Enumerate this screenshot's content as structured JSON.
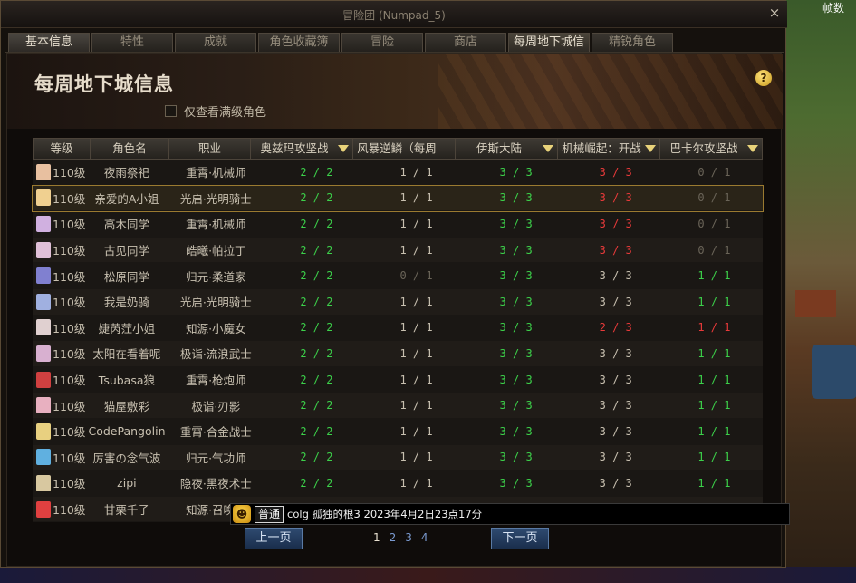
{
  "fps_label": "帧数",
  "window": {
    "title": "冒险团 (Numpad_5)",
    "close": "×"
  },
  "tabs": [
    {
      "label": "基本信息"
    },
    {
      "label": "特性"
    },
    {
      "label": "成就"
    },
    {
      "label": "角色收藏簿"
    },
    {
      "label": "冒险"
    },
    {
      "label": "商店"
    },
    {
      "label": "每周地下城信息"
    },
    {
      "label": "精锐角色"
    }
  ],
  "active_tab": "每周地下城信息",
  "page": {
    "title": "每周地下城信息",
    "help": "?",
    "filter_label": "仅查看满级角色"
  },
  "table": {
    "headers": {
      "level": "等级",
      "name": "角色名",
      "job": "职业",
      "d1": "奥兹玛攻坚战",
      "d2": "风暴逆鳞（每周",
      "d3": "伊斯大陆",
      "d4": "机械崛起：开战",
      "d5": "巴卡尔攻坚战"
    },
    "rows": [
      {
        "level": "110级",
        "name": "夜雨祭祀",
        "job": "重霄·机械师",
        "d1": "2 / 2",
        "d2": "1 / 1",
        "d3": "3 / 3",
        "d4": "3 / 3",
        "d5": "0 / 1",
        "c1": "green",
        "c2": "white",
        "c3": "green",
        "c4": "red",
        "c5": "grey",
        "avatar": "#e8c0a0"
      },
      {
        "level": "110级",
        "name": "亲爱的A小姐",
        "job": "光启·光明骑士",
        "d1": "2 / 2",
        "d2": "1 / 1",
        "d3": "3 / 3",
        "d4": "3 / 3",
        "d5": "0 / 1",
        "c1": "green",
        "c2": "white",
        "c3": "green",
        "c4": "red",
        "c5": "grey",
        "avatar": "#f0d090"
      },
      {
        "level": "110级",
        "name": "高木同学",
        "job": "重霄·机械师",
        "d1": "2 / 2",
        "d2": "1 / 1",
        "d3": "3 / 3",
        "d4": "3 / 3",
        "d5": "0 / 1",
        "c1": "green",
        "c2": "white",
        "c3": "green",
        "c4": "red",
        "c5": "grey",
        "avatar": "#d0b0e0"
      },
      {
        "level": "110级",
        "name": "古见同学",
        "job": "皓曦·帕拉丁",
        "d1": "2 / 2",
        "d2": "1 / 1",
        "d3": "3 / 3",
        "d4": "3 / 3",
        "d5": "0 / 1",
        "c1": "green",
        "c2": "white",
        "c3": "green",
        "c4": "red",
        "c5": "grey",
        "avatar": "#e0c0d8"
      },
      {
        "level": "110级",
        "name": "松原同学",
        "job": "归元·柔道家",
        "d1": "2 / 2",
        "d2": "0 / 1",
        "d3": "3 / 3",
        "d4": "3 / 3",
        "d5": "1 / 1",
        "c1": "green",
        "c2": "grey",
        "c3": "green",
        "c4": "white",
        "c5": "green",
        "avatar": "#8080d0"
      },
      {
        "level": "110级",
        "name": "我是奶骑",
        "job": "光启·光明骑士",
        "d1": "2 / 2",
        "d2": "1 / 1",
        "d3": "3 / 3",
        "d4": "3 / 3",
        "d5": "1 / 1",
        "c1": "green",
        "c2": "white",
        "c3": "green",
        "c4": "white",
        "c5": "green",
        "avatar": "#a0b0e0"
      },
      {
        "level": "110级",
        "name": "婕芮茳小姐",
        "job": "知源·小魔女",
        "d1": "2 / 2",
        "d2": "1 / 1",
        "d3": "3 / 3",
        "d4": "2 / 3",
        "d5": "1 / 1",
        "c1": "green",
        "c2": "white",
        "c3": "green",
        "c4": "red",
        "c5": "red",
        "avatar": "#e0d0d0"
      },
      {
        "level": "110级",
        "name": "太阳在看着呢",
        "job": "极诣·流浪武士",
        "d1": "2 / 2",
        "d2": "1 / 1",
        "d3": "3 / 3",
        "d4": "3 / 3",
        "d5": "1 / 1",
        "c1": "green",
        "c2": "white",
        "c3": "green",
        "c4": "white",
        "c5": "green",
        "avatar": "#d8b0d0"
      },
      {
        "level": "110级",
        "name": "Tsubasa狼",
        "job": "重霄·枪炮师",
        "d1": "2 / 2",
        "d2": "1 / 1",
        "d3": "3 / 3",
        "d4": "3 / 3",
        "d5": "1 / 1",
        "c1": "green",
        "c2": "white",
        "c3": "green",
        "c4": "white",
        "c5": "green",
        "avatar": "#d04040"
      },
      {
        "level": "110级",
        "name": "猫屋敷彩",
        "job": "极诣·刃影",
        "d1": "2 / 2",
        "d2": "1 / 1",
        "d3": "3 / 3",
        "d4": "3 / 3",
        "d5": "1 / 1",
        "c1": "green",
        "c2": "white",
        "c3": "green",
        "c4": "white",
        "c5": "green",
        "avatar": "#e8b0c0"
      },
      {
        "level": "110级",
        "name": "CodePangolin",
        "job": "重霄·合金战士",
        "d1": "2 / 2",
        "d2": "1 / 1",
        "d3": "3 / 3",
        "d4": "3 / 3",
        "d5": "1 / 1",
        "c1": "green",
        "c2": "white",
        "c3": "green",
        "c4": "white",
        "c5": "green",
        "avatar": "#e8d080"
      },
      {
        "level": "110级",
        "name": "厉害の念气波",
        "job": "归元·气功师",
        "d1": "2 / 2",
        "d2": "1 / 1",
        "d3": "3 / 3",
        "d4": "3 / 3",
        "d5": "1 / 1",
        "c1": "green",
        "c2": "white",
        "c3": "green",
        "c4": "white",
        "c5": "green",
        "avatar": "#60b0e0"
      },
      {
        "level": "110级",
        "name": "zipi",
        "job": "隐夜·黑夜术士",
        "d1": "2 / 2",
        "d2": "1 / 1",
        "d3": "3 / 3",
        "d4": "3 / 3",
        "d5": "1 / 1",
        "c1": "green",
        "c2": "white",
        "c3": "green",
        "c4": "white",
        "c5": "green",
        "avatar": "#d8c8a0"
      },
      {
        "level": "110级",
        "name": "甘栗千子",
        "job": "知源·召唤师",
        "d1": "",
        "d2": "",
        "d3": "",
        "d4": "",
        "d5": "",
        "c1": "green",
        "c2": "white",
        "c3": "green",
        "c4": "white",
        "c5": "green",
        "avatar": "#e04040"
      }
    ]
  },
  "pager": {
    "prev": "上一页",
    "next": "下一页",
    "pages": [
      "1",
      "2",
      "3",
      "4"
    ],
    "current": "1"
  },
  "chat": {
    "icon": "☻",
    "channel": "普通",
    "message": "colg 孤独的根3 2023年4月2日23点17分"
  }
}
